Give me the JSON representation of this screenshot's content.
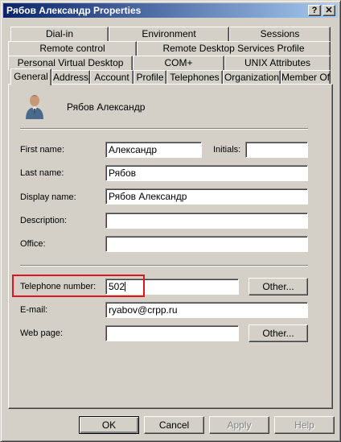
{
  "window": {
    "title": "Рябов Александр Properties"
  },
  "titlebar_buttons": {
    "help": "?",
    "close": "✕"
  },
  "tabs": {
    "row1": [
      "Dial-in",
      "Environment",
      "Sessions"
    ],
    "row2": [
      "Remote control",
      "Remote Desktop Services Profile"
    ],
    "row3": [
      "Personal Virtual Desktop",
      "COM+",
      "UNIX Attributes"
    ],
    "row4": [
      "General",
      "Address",
      "Account",
      "Profile",
      "Telephones",
      "Organization",
      "Member Of"
    ]
  },
  "header": {
    "display_name": "Рябов Александр",
    "icon": "user-icon"
  },
  "form": {
    "first_name_label": "First name:",
    "first_name": "Александр",
    "initials_label": "Initials:",
    "initials": "",
    "last_name_label": "Last name:",
    "last_name": "Рябов",
    "display_name_label": "Display name:",
    "display_name": "Рябов Александр",
    "description_label": "Description:",
    "description": "",
    "office_label": "Office:",
    "office": "",
    "telephone_label": "Telephone number:",
    "telephone": "502",
    "telephone_other": "Other...",
    "email_label": "E-mail:",
    "email": "ryabov@crpp.ru",
    "webpage_label": "Web page:",
    "webpage": "",
    "webpage_other": "Other..."
  },
  "buttons": {
    "ok": "OK",
    "cancel": "Cancel",
    "apply": "Apply",
    "help": "Help"
  },
  "colors": {
    "titlebar_start": "#0a246a",
    "titlebar_end": "#a6caf0",
    "highlight": "#e0141e",
    "face": "#d4d0c8"
  }
}
